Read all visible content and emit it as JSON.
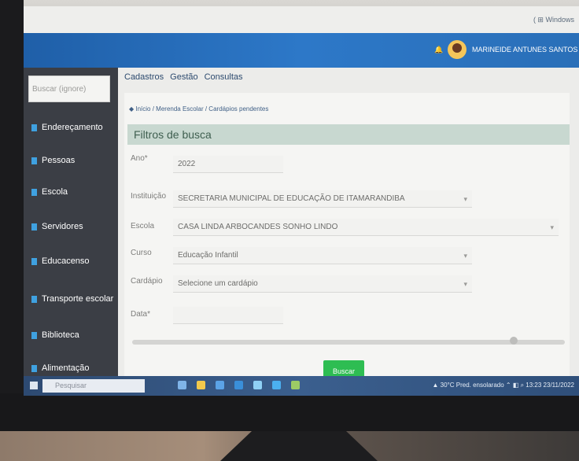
{
  "browser": {
    "tab_hint": "( ⊞ Windows"
  },
  "header": {
    "user_name": "MARINEIDE ANTUNES SANTOS ▾",
    "bell_glyph": "🔔"
  },
  "sidebar": {
    "search_placeholder": "Buscar (ignore)",
    "items": [
      {
        "label": "Endereçamento",
        "icon": "map-icon"
      },
      {
        "label": "Pessoas",
        "icon": "person-icon"
      },
      {
        "label": "Escola",
        "icon": "school-icon"
      },
      {
        "label": "Servidores",
        "icon": "staff-icon"
      },
      {
        "label": "Educacenso",
        "icon": "chart-icon"
      },
      {
        "label": "Transporte escolar",
        "icon": "bus-icon"
      },
      {
        "label": "Biblioteca",
        "icon": "book-icon"
      },
      {
        "label": "Alimentação",
        "icon": "food-icon"
      }
    ]
  },
  "top_menu": [
    "Cadastros",
    "Gestão",
    "Consultas"
  ],
  "breadcrumb": "◆ Início / Merenda Escolar / Cardápios pendentes",
  "filter_title": "Filtros de busca",
  "filters": [
    {
      "label": "Ano*",
      "value": "2022",
      "dropdown": false
    },
    {
      "label": "Instituição",
      "value": "SECRETARIA MUNICIPAL DE EDUCAÇÃO DE ITAMARANDIBA",
      "dropdown": true
    },
    {
      "label": "Escola",
      "value": "CASA LINDA ARBOCANDES SONHO LINDO",
      "dropdown": true
    },
    {
      "label": "Curso",
      "value": "Educação Infantil",
      "dropdown": true
    },
    {
      "label": "Cardápio",
      "value": "Selecione um cardápio",
      "dropdown": true
    },
    {
      "label": "Data*",
      "value": "",
      "dropdown": false
    }
  ],
  "search_button": "Buscar",
  "taskbar": {
    "search_placeholder": "Pesquisar",
    "tray_text": "▲ 30°C Pred. ensolarado   ⌃ ◧ ⌕  13:23  23/11/2022"
  }
}
